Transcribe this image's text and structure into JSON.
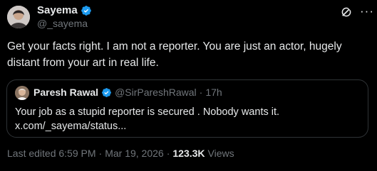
{
  "author": {
    "name": "Sayema",
    "handle": "@_sayema"
  },
  "tweet": {
    "line1": "Get your facts right. I am not a reporter. You are just an actor, hugely",
    "line2": "distant from your art in real life."
  },
  "quoted": {
    "name": "Paresh Rawal",
    "handle": "@SirPareshRawal",
    "separator": "·",
    "time": "17h",
    "line1": "Your job as a stupid reporter is secured . Nobody wants it.",
    "line2": "x.com/_sayema/status..."
  },
  "meta": {
    "edited": "Last edited 6:59 PM",
    "separator": "·",
    "date": "Mar 19, 2026",
    "separator2": "·",
    "views_count": "123.3K",
    "views_label": "Views"
  },
  "colors": {
    "verified": "#1d9bf0",
    "background": "#000000",
    "muted": "#71767b"
  }
}
